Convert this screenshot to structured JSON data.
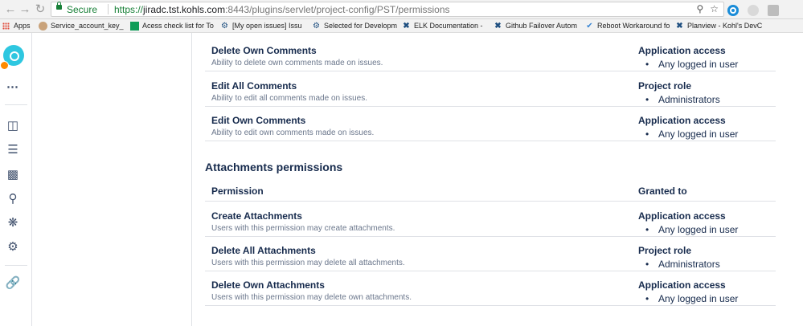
{
  "browser": {
    "secure_label": "Secure",
    "url_proto": "https://",
    "url_host": "jiradc.tst.kohls.com",
    "url_path": ":8443/plugins/servlet/project-config/PST/permissions",
    "bookmarks": [
      {
        "label": "Apps",
        "icon": "apps-grid-icon"
      },
      {
        "label": "Service_account_key_",
        "icon": "person-icon"
      },
      {
        "label": "Acess check list for To",
        "icon": "sheets-icon"
      },
      {
        "label": "[My open issues] Issu",
        "icon": "jira-icon"
      },
      {
        "label": "Selected for Developm",
        "icon": "jira-icon"
      },
      {
        "label": "ELK Documentation -",
        "icon": "confluence-icon"
      },
      {
        "label": "Github Failover Autom",
        "icon": "confluence-icon"
      },
      {
        "label": "Reboot Workaround fo",
        "icon": "check-icon"
      },
      {
        "label": "Planview - Kohl's DevC",
        "icon": "confluence-icon"
      }
    ]
  },
  "permissions_top": [
    {
      "name": "Delete Own Comments",
      "desc": "Ability to delete own comments made on issues.",
      "grant_type": "Application access",
      "grant_value": "Any logged in user"
    },
    {
      "name": "Edit All Comments",
      "desc": "Ability to edit all comments made on issues.",
      "grant_type": "Project role",
      "grant_value": "Administrators"
    },
    {
      "name": "Edit Own Comments",
      "desc": "Ability to edit own comments made on issues.",
      "grant_type": "Application access",
      "grant_value": "Any logged in user"
    }
  ],
  "attachments": {
    "title": "Attachments permissions",
    "col_permission": "Permission",
    "col_granted": "Granted to",
    "rows": [
      {
        "name": "Create Attachments",
        "desc": "Users with this permission may create attachments.",
        "grant_type": "Application access",
        "grant_value": "Any logged in user"
      },
      {
        "name": "Delete All Attachments",
        "desc": "Users with this permission may delete all attachments.",
        "grant_type": "Project role",
        "grant_value": "Administrators"
      },
      {
        "name": "Delete Own Attachments",
        "desc": "Users with this permission may delete own attachments.",
        "grant_type": "Application access",
        "grant_value": "Any logged in user"
      }
    ]
  }
}
